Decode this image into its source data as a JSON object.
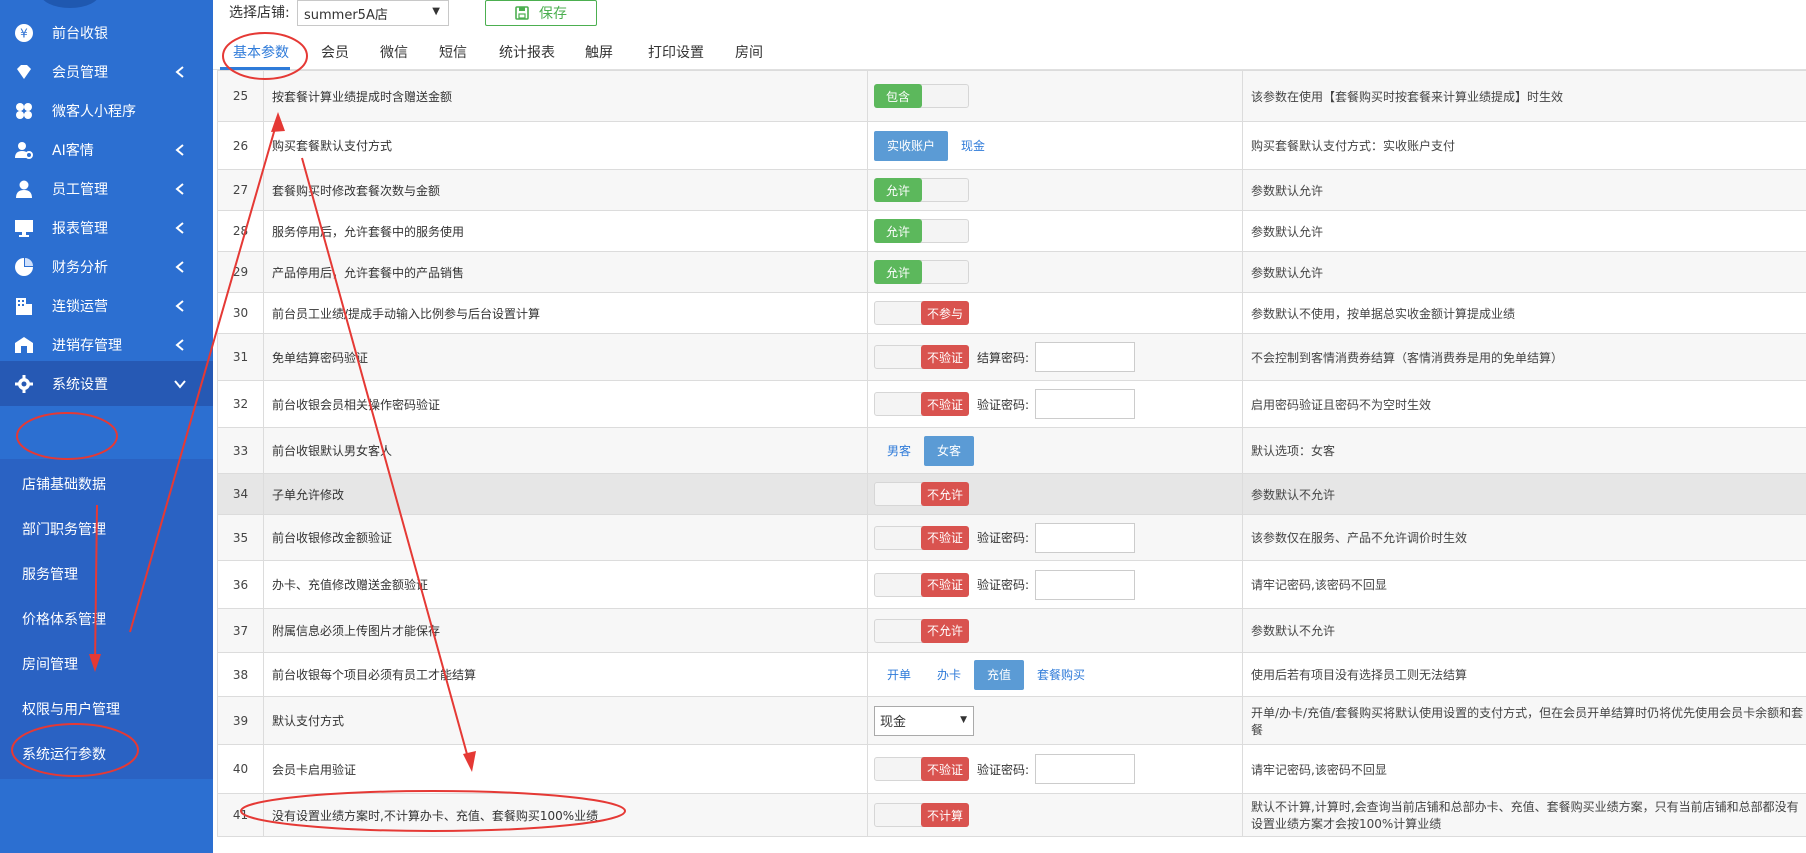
{
  "sidebar": {
    "items": [
      {
        "label": "前台收银",
        "icon": "yen-icon",
        "chevron": ""
      },
      {
        "label": "会员管理",
        "icon": "diamond-icon",
        "chevron": "left"
      },
      {
        "label": "微客人小程序",
        "icon": "flower-icon",
        "chevron": ""
      },
      {
        "label": "AI客情",
        "icon": "user-gear-icon",
        "chevron": "left"
      },
      {
        "label": "员工管理",
        "icon": "person-icon",
        "chevron": "left"
      },
      {
        "label": "报表管理",
        "icon": "monitor-icon",
        "chevron": "left"
      },
      {
        "label": "财务分析",
        "icon": "pie-chart-icon",
        "chevron": "left"
      },
      {
        "label": "连锁运营",
        "icon": "building-icon",
        "chevron": "left"
      },
      {
        "label": "进销存管理",
        "icon": "warehouse-icon",
        "chevron": "left"
      },
      {
        "label": "系统设置",
        "icon": "gear-icon",
        "chevron": "down"
      }
    ],
    "subitems": [
      "店铺基础数据",
      "部门职务管理",
      "服务管理",
      "价格体系管理",
      "房间管理",
      "权限与用户管理",
      "系统运行参数"
    ]
  },
  "topbar": {
    "store_label": "选择店铺:",
    "store_value": "summer5A店",
    "save_label": "保存"
  },
  "tabs": [
    "基本参数",
    "会员",
    "微信",
    "短信",
    "统计报表",
    "触屏",
    "打印设置",
    "房间"
  ],
  "rows": [
    {
      "num": "25",
      "name": "按套餐计算业绩提成时含赠送金额",
      "desc": "该参数在使用【套餐购买时按套餐来计算业绩提成】时生效",
      "toggle": {
        "label": "包含",
        "state": "on"
      }
    },
    {
      "num": "26",
      "name": "购买套餐默认支付方式",
      "desc": "购买套餐默认支付方式：实收账户支付",
      "options": [
        "实收账户",
        "现金"
      ],
      "selected": 0
    },
    {
      "num": "27",
      "name": "套餐购买时修改套餐次数与金额",
      "desc": "参数默认允许",
      "toggle": {
        "label": "允许",
        "state": "on"
      }
    },
    {
      "num": "28",
      "name": "服务停用后，允许套餐中的服务使用",
      "desc": "参数默认允许",
      "toggle": {
        "label": "允许",
        "state": "on"
      }
    },
    {
      "num": "29",
      "name": "产品停用后，允许套餐中的产品销售",
      "desc": "参数默认允许",
      "toggle": {
        "label": "允许",
        "state": "on"
      }
    },
    {
      "num": "30",
      "name": "前台员工业绩/提成手动输入比例参与后台设置计算",
      "desc": "参数默认不使用，按单据总实收金额计算提成业绩",
      "toggle": {
        "label": "不参与",
        "state": "off"
      }
    },
    {
      "num": "31",
      "name": "免单结算密码验证",
      "desc": "不会控制到客情消费券结算（客情消费券是用的免单结算）",
      "toggle": {
        "label": "不验证",
        "state": "off"
      },
      "pwd_label": "结算密码:"
    },
    {
      "num": "32",
      "name": "前台收银会员相关操作密码验证",
      "desc": "启用密码验证且密码不为空时生效",
      "toggle": {
        "label": "不验证",
        "state": "off"
      },
      "pwd_label": "验证密码:"
    },
    {
      "num": "33",
      "name": "前台收银默认男女客人",
      "desc": "默认选项：女客",
      "options": [
        "男客",
        "女客"
      ],
      "selected": 1
    },
    {
      "num": "34",
      "name": "子单允许修改",
      "desc": "参数默认不允许",
      "toggle": {
        "label": "不允许",
        "state": "off"
      }
    },
    {
      "num": "35",
      "name": "前台收银修改金额验证",
      "desc": "该参数仅在服务、产品不允许调价时生效",
      "toggle": {
        "label": "不验证",
        "state": "off"
      },
      "pwd_label": "验证密码:"
    },
    {
      "num": "36",
      "name": "办卡、充值修改赠送金额验证",
      "desc": "请牢记密码,该密码不回显",
      "toggle": {
        "label": "不验证",
        "state": "off"
      },
      "pwd_label": "验证密码:"
    },
    {
      "num": "37",
      "name": "附属信息必须上传图片才能保存",
      "desc": "参数默认不允许",
      "toggle": {
        "label": "不允许",
        "state": "off"
      }
    },
    {
      "num": "38",
      "name": "前台收银每个项目必须有员工才能结算",
      "desc": "使用后若有项目没有选择员工则无法结算",
      "options": [
        "开单",
        "办卡",
        "充值",
        "套餐购买"
      ],
      "selected": 2
    },
    {
      "num": "39",
      "name": "默认支付方式",
      "desc": "开单/办卡/充值/套餐购买将默认使用设置的支付方式，但在会员开单结算时仍将优先使用会员卡余额和套餐",
      "select": "现金"
    },
    {
      "num": "40",
      "name": "会员卡启用验证",
      "desc": "请牢记密码,该密码不回显",
      "toggle": {
        "label": "不验证",
        "state": "off"
      },
      "pwd_label": "验证密码:"
    },
    {
      "num": "41",
      "name": "没有设置业绩方案时,不计算办卡、充值、套餐购买100%业绩",
      "desc": "默认不计算,计算时,会查询当前店铺和总部办卡、充值、套餐购买业绩方案，只有当前店铺和总部都没有设置业绩方案才会按100%计算业绩",
      "toggle": {
        "label": "不计算",
        "state": "off"
      }
    }
  ],
  "colors": {
    "sidebar": "#2c6fd1",
    "accent": "#2f7bd9",
    "on": "#5cb85c",
    "off": "#d9534f",
    "annotation": "#e53935"
  }
}
